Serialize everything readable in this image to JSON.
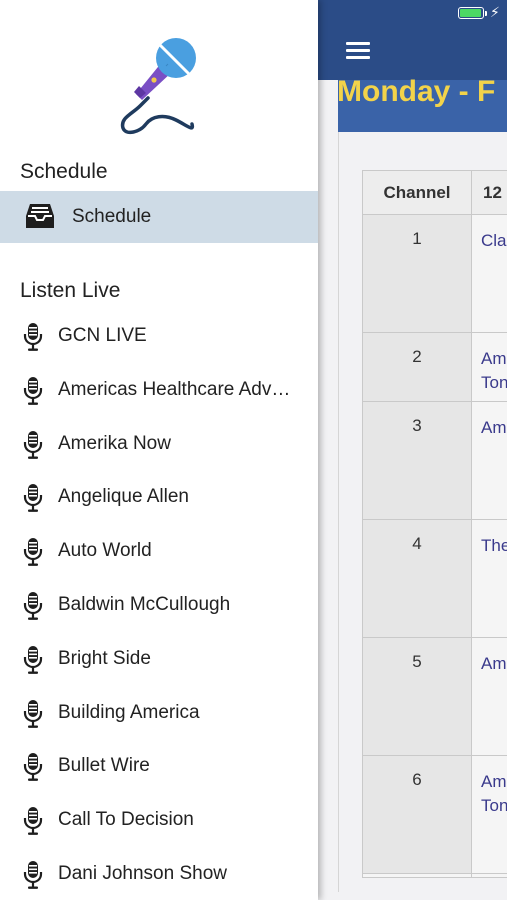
{
  "main": {
    "day_title": "Monday - F",
    "table": {
      "header_channel": "Channel",
      "header_time": "12",
      "rows": [
        {
          "channel": "1",
          "lines": [
            "Cla"
          ]
        },
        {
          "channel": "2",
          "lines": [
            "Am",
            "Ton"
          ]
        },
        {
          "channel": "3",
          "lines": [
            "Am"
          ]
        },
        {
          "channel": "4",
          "lines": [
            "The"
          ]
        },
        {
          "channel": "5",
          "lines": [
            "Am"
          ]
        },
        {
          "channel": "6",
          "lines": [
            "Am",
            "Ton"
          ]
        }
      ]
    }
  },
  "drawer": {
    "logo_icon": "microphone-logo",
    "schedule_heading": "Schedule",
    "schedule_item": {
      "label": "Schedule",
      "icon": "inbox-tray-icon"
    },
    "listen_live_heading": "Listen Live",
    "live_items": [
      {
        "label": "GCN LIVE",
        "icon": "microphone-icon"
      },
      {
        "label": "Americas Healthcare Adv…",
        "icon": "microphone-icon"
      },
      {
        "label": "Amerika Now",
        "icon": "microphone-icon"
      },
      {
        "label": "Angelique Allen",
        "icon": "microphone-icon"
      },
      {
        "label": "Auto World",
        "icon": "microphone-icon"
      },
      {
        "label": "Baldwin McCullough",
        "icon": "microphone-icon"
      },
      {
        "label": "Bright Side",
        "icon": "microphone-icon"
      },
      {
        "label": "Building America",
        "icon": "microphone-icon"
      },
      {
        "label": "Bullet Wire",
        "icon": "microphone-icon"
      },
      {
        "label": "Call To Decision",
        "icon": "microphone-icon"
      },
      {
        "label": "Dani Johnson Show",
        "icon": "microphone-icon"
      }
    ]
  },
  "status_bar": {
    "battery_level": 1.0
  },
  "colors": {
    "nav_bar": "#2b4c87",
    "day_banner": "#3a63a8",
    "day_title_text": "#f2d34a",
    "selected_row": "#cedbe6",
    "program_link": "#3a3a8c",
    "logo_mic_head": "#4a9fe0",
    "logo_mic_handle": "#7a4fc4",
    "logo_cable": "#1f3b5e"
  }
}
